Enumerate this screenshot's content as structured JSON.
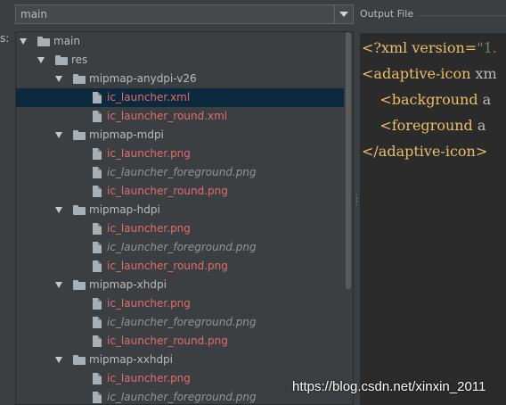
{
  "module_select": {
    "value": "main"
  },
  "left_edge_fragment": "s:",
  "output_header": {
    "title": "Output File"
  },
  "tree": [
    {
      "label": "main",
      "kind": "folder",
      "depth": 0,
      "expanded": true,
      "style": "folder"
    },
    {
      "label": "res",
      "kind": "folder",
      "depth": 1,
      "expanded": true,
      "style": "folder"
    },
    {
      "label": "mipmap-anydpi-v26",
      "kind": "folder",
      "depth": 2,
      "expanded": true,
      "style": "folder"
    },
    {
      "label": "ic_launcher.xml",
      "kind": "file",
      "depth": 3,
      "style": "red",
      "selected": true
    },
    {
      "label": "ic_launcher_round.xml",
      "kind": "file",
      "depth": 3,
      "style": "red"
    },
    {
      "label": "mipmap-mdpi",
      "kind": "folder",
      "depth": 2,
      "expanded": true,
      "style": "folder"
    },
    {
      "label": "ic_launcher.png",
      "kind": "file",
      "depth": 3,
      "style": "red"
    },
    {
      "label": "ic_launcher_foreground.png",
      "kind": "file",
      "depth": 3,
      "style": "italic"
    },
    {
      "label": "ic_launcher_round.png",
      "kind": "file",
      "depth": 3,
      "style": "red"
    },
    {
      "label": "mipmap-hdpi",
      "kind": "folder",
      "depth": 2,
      "expanded": true,
      "style": "folder"
    },
    {
      "label": "ic_launcher.png",
      "kind": "file",
      "depth": 3,
      "style": "red"
    },
    {
      "label": "ic_launcher_foreground.png",
      "kind": "file",
      "depth": 3,
      "style": "italic"
    },
    {
      "label": "ic_launcher_round.png",
      "kind": "file",
      "depth": 3,
      "style": "red"
    },
    {
      "label": "mipmap-xhdpi",
      "kind": "folder",
      "depth": 2,
      "expanded": true,
      "style": "folder"
    },
    {
      "label": "ic_launcher.png",
      "kind": "file",
      "depth": 3,
      "style": "red"
    },
    {
      "label": "ic_launcher_foreground.png",
      "kind": "file",
      "depth": 3,
      "style": "italic"
    },
    {
      "label": "ic_launcher_round.png",
      "kind": "file",
      "depth": 3,
      "style": "red"
    },
    {
      "label": "mipmap-xxhdpi",
      "kind": "folder",
      "depth": 2,
      "expanded": true,
      "style": "folder"
    },
    {
      "label": "ic_launcher.png",
      "kind": "file",
      "depth": 3,
      "style": "red"
    },
    {
      "label": "ic_launcher_foreground.png",
      "kind": "file",
      "depth": 3,
      "style": "italic"
    }
  ],
  "code_lines": [
    {
      "parts": [
        {
          "t": "<?xml version=",
          "c": "tag"
        },
        {
          "t": "\"1.",
          "c": "str"
        }
      ]
    },
    {
      "parts": [
        {
          "t": "<adaptive-icon ",
          "c": "tag"
        },
        {
          "t": "xm",
          "c": "attr"
        }
      ]
    },
    {
      "parts": [
        {
          "t": "    <background ",
          "c": "tag"
        },
        {
          "t": "a",
          "c": "attr"
        }
      ]
    },
    {
      "parts": [
        {
          "t": "    <foreground ",
          "c": "tag"
        },
        {
          "t": "a",
          "c": "attr"
        }
      ]
    },
    {
      "parts": [
        {
          "t": "</adaptive-icon>",
          "c": "tag"
        }
      ]
    }
  ],
  "watermark": "https://blog.csdn.net/xinxin_2011",
  "colors": {
    "selection": "#0d293e",
    "modified_file": "#e06c6c",
    "unversioned_file": "#8f9599",
    "editor_bg": "#2b2b2b"
  }
}
